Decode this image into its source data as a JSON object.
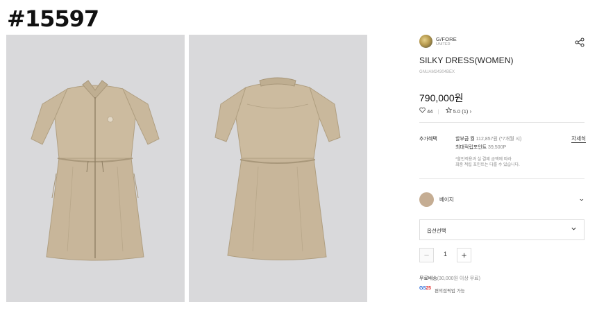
{
  "post_id": "#15597",
  "images": {
    "front_alt": "dress-front",
    "back_alt": "dress-back"
  },
  "brand": {
    "name": "G/FORE",
    "sub": "UNITED"
  },
  "product": {
    "name": "SILKY DRESS(WOMEN)",
    "code": "GNUAM24304BEX",
    "price": "790,000원"
  },
  "stats": {
    "likes": "44",
    "rating": "5.0",
    "reviews": "(1)",
    "review_chevron": "›"
  },
  "benefits": {
    "label": "추가혜택",
    "installment_label": "할부금 월",
    "installment_value": "112,857원 (*7개월 시)",
    "points_label": "최대적립포인트",
    "points_value": "39,500P",
    "note_line1": "*할인적용과 실 결제 금액에 따라",
    "note_line2": "최종 적립 포인트는 다를 수 있습니다.",
    "detail_link": "자세히"
  },
  "color": {
    "name": "베이지",
    "swatch": "#c5ad93",
    "chevron": "⌄"
  },
  "option": {
    "placeholder": "옵션선택"
  },
  "quantity": {
    "minus": "−",
    "value": "1",
    "plus": "+"
  },
  "shipping": {
    "label": "무료배송",
    "condition": "(30,000원 이상 무료)"
  },
  "pickup": {
    "logo_gs": "GS",
    "logo_25": "25",
    "text": "편의점픽업 가능"
  },
  "colors": {
    "photo_bg": "#d9d9db",
    "dress_main": "#c9b89c",
    "dress_shadow": "#b3a183"
  }
}
